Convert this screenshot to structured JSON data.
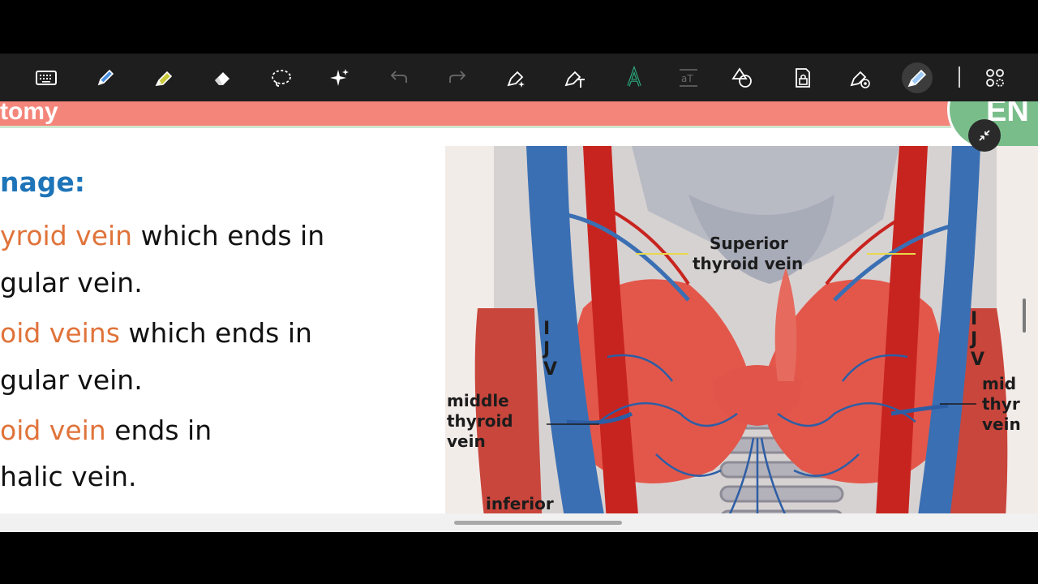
{
  "toolbar": {
    "tools": [
      {
        "name": "keyboard-tool",
        "icon": "keyboard-icon"
      },
      {
        "name": "pen-tool",
        "icon": "pen-icon",
        "color": "#4a90e2"
      },
      {
        "name": "highlighter-tool",
        "icon": "highlighter-icon",
        "color": "#c8c83a"
      },
      {
        "name": "eraser-tool",
        "icon": "eraser-icon"
      },
      {
        "name": "lasso-tool",
        "icon": "lasso-icon"
      },
      {
        "name": "ai-tool",
        "icon": "sparkle-icon"
      },
      {
        "name": "undo-tool",
        "icon": "undo-icon"
      },
      {
        "name": "redo-tool",
        "icon": "redo-icon"
      },
      {
        "name": "pen-settings-tool",
        "icon": "pen-sparkle-icon"
      },
      {
        "name": "text-tool",
        "icon": "text-pen-icon"
      },
      {
        "name": "font-tool",
        "icon": "font-a-icon",
        "color": "#2fa37a"
      },
      {
        "name": "text-box-tool",
        "icon": "text-box-icon"
      },
      {
        "name": "shapes-tool",
        "icon": "shapes-icon"
      },
      {
        "name": "lock-tool",
        "icon": "lock-page-icon"
      },
      {
        "name": "laser-tool",
        "icon": "laser-pen-icon"
      },
      {
        "name": "active-pen-tool",
        "icon": "active-pen-icon",
        "color": "#9cc9f5"
      },
      {
        "name": "more-tool",
        "icon": "grid-gear-icon"
      }
    ]
  },
  "slide": {
    "header_title": "tomy",
    "logo_text": "EN",
    "heading": "nage:",
    "lines": [
      {
        "orange": "yroid vein",
        "rest": " which ends in"
      },
      {
        "orange": "",
        "rest": "gular vein."
      },
      {
        "orange": "oid veins",
        "rest": " which ends in"
      },
      {
        "orange": "",
        "rest": "gular vein."
      },
      {
        "orange": "oid vein",
        "rest": " ends in"
      },
      {
        "orange": "",
        "rest": "halic vein."
      }
    ],
    "figure_labels": {
      "superior": "Superior",
      "thyroid_vein": "thyroid vein",
      "ijv_left": [
        "I",
        "J",
        "V"
      ],
      "ijv_right": [
        "I",
        "J",
        "V"
      ],
      "middle_left": [
        "middle",
        "thyroid",
        "vein"
      ],
      "middle_right": [
        "mid",
        "thyr",
        "vein"
      ],
      "inferior": "inferior"
    }
  },
  "colors": {
    "header_band": "#f4857a",
    "accent_orange": "#e0733a",
    "heading_blue": "#1d74b8"
  }
}
